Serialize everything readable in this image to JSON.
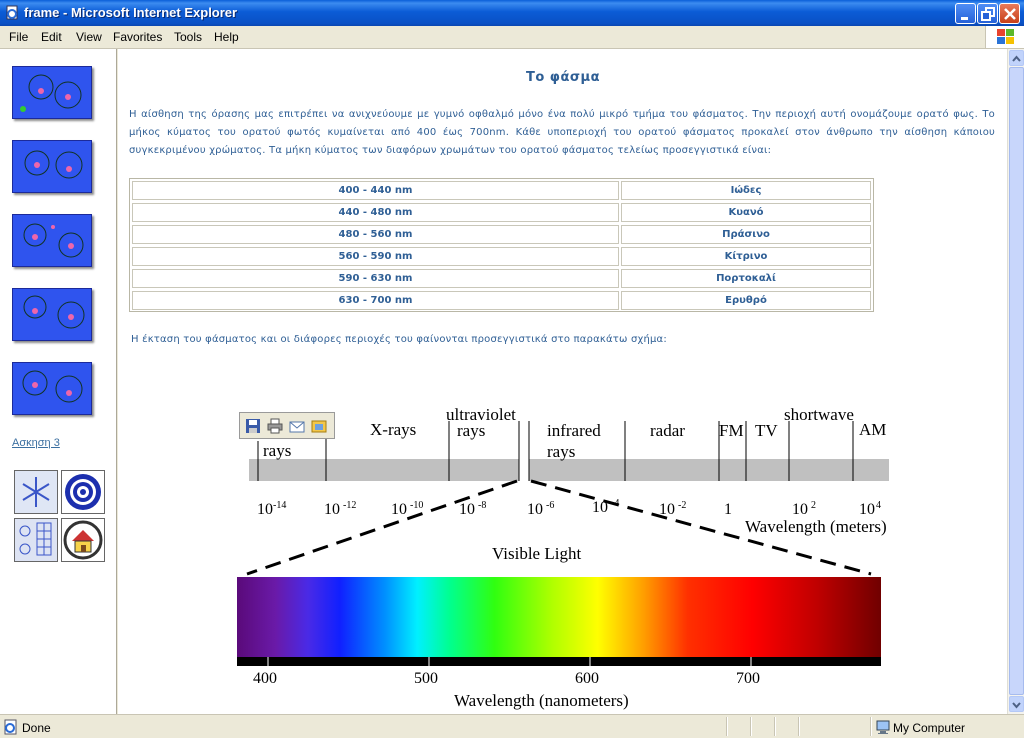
{
  "window": {
    "title": "frame - Microsoft Internet Explorer"
  },
  "menu": [
    "File",
    "Edit",
    "View",
    "Favorites",
    "Tools",
    "Help"
  ],
  "sidebar": {
    "link_label": "Ασκηση 3"
  },
  "content": {
    "title": "Το φάσμα",
    "intro_1": "Η αίσθηση της όρασης μας επιτρέπει να ανιχνεύουμε με γυμνό οφθαλμό μόνο ένα πολύ μικρό τμήμα του φάσματος. Την περιοχή αυτή ονομάζουμε ορατό φως. Το",
    "intro_2": "μήκος κύματος του ορατού φωτός κυμαίνεται από 400 έως 700nm. Κάθε υποπεριοχή του ορατού φάσματος προκαλεί στον άνθρωπο την αίσθηση κάποιου",
    "intro_3": "συγκεκριμένου χρώματος. Τα μήκη κύματος των διαφόρων χρωμάτων του ορατού φάσματος τελείως προσεγγιστικά είναι:",
    "color_table": [
      {
        "range": "400 - 440 nm",
        "color": "Ιώδες"
      },
      {
        "range": "440 - 480 nm",
        "color": "Κυανό"
      },
      {
        "range": "480 - 560 nm",
        "color": "Πράσινο"
      },
      {
        "range": "560 - 590 nm",
        "color": "Κίτρινο"
      },
      {
        "range": "590 - 630 nm",
        "color": "Πορτοκαλί"
      },
      {
        "range": "630 - 700 nm",
        "color": "Ερυθρό"
      }
    ],
    "spectrum_text": "Η έκταση του φάσματος και οι διάφορες περιοχές του φαίνονται προσεγγιστικά στο παρακάτω σχήμα:"
  },
  "diagram": {
    "regions": {
      "gamma": "rays",
      "xrays": "X-rays",
      "uv_1": "ultraviolet",
      "uv_2": "rays",
      "ir_1": "infrared",
      "ir_2": "rays",
      "radar": "radar",
      "fm": "FM",
      "tv": "TV",
      "shortwave": "shortwave",
      "am": "AM"
    },
    "wavelength_ticks": [
      {
        "base": "10",
        "exp": "-14"
      },
      {
        "base": "10",
        "exp": "-12"
      },
      {
        "base": "10",
        "exp": "-10"
      },
      {
        "base": "10",
        "exp": "-8"
      },
      {
        "base": "10",
        "exp": "-6"
      },
      {
        "base": "10",
        "exp": "-4"
      },
      {
        "base": "10",
        "exp": "-2"
      },
      {
        "base": "1",
        "exp": ""
      },
      {
        "base": "10",
        "exp": "2"
      },
      {
        "base": "10",
        "exp": "4"
      }
    ],
    "axis_label_meters": "Wavelength (meters)",
    "visible_label": "Visible Light",
    "nm_ticks": [
      "400",
      "500",
      "600",
      "700"
    ],
    "axis_label_nm": "Wavelength (nanometers)"
  },
  "status": {
    "left": "Done",
    "zone": "My Computer"
  }
}
